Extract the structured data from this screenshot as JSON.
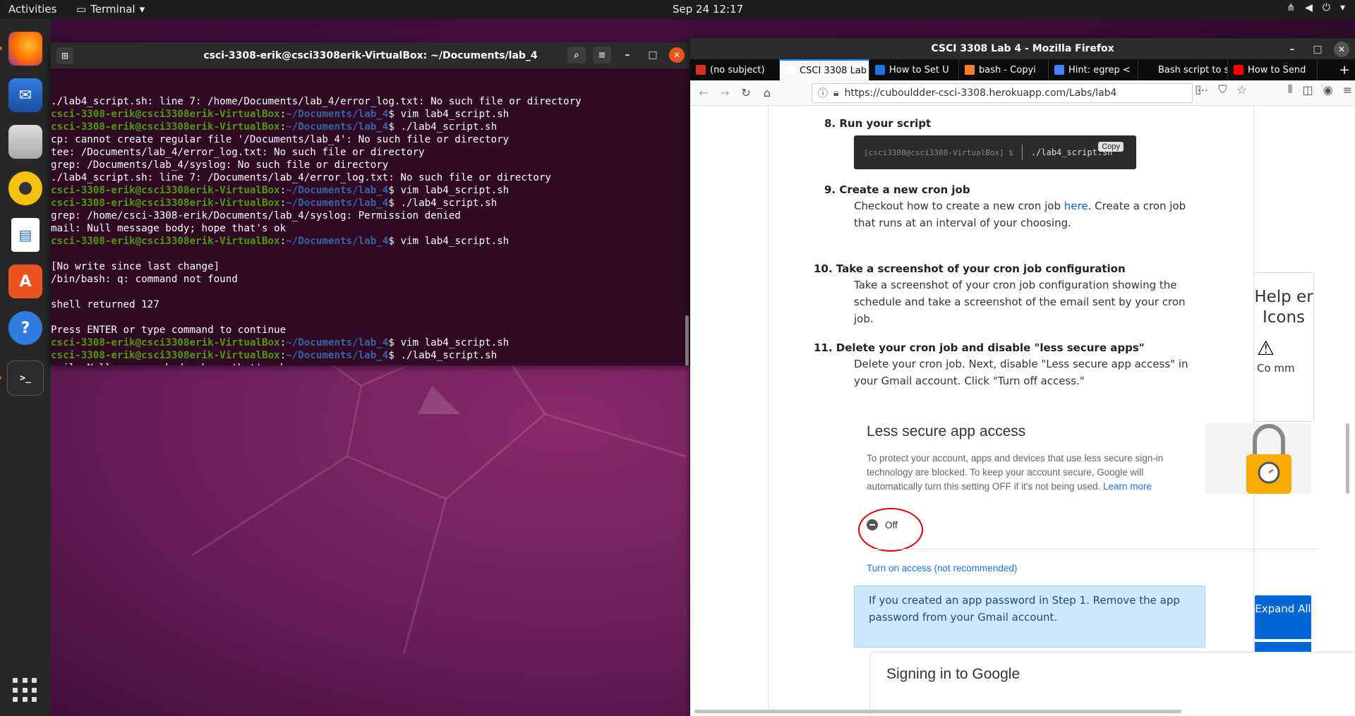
{
  "topbar": {
    "activities": "Activities",
    "app_name": "Terminal",
    "clock": "Sep 24  12:17"
  },
  "dock": {
    "items": [
      "firefox-icon",
      "thunderbird-icon",
      "files-icon",
      "rhythmbox-icon",
      "libreoffice-writer-icon",
      "ubuntu-software-icon",
      "help-icon",
      "terminal-icon"
    ]
  },
  "terminal": {
    "title": "csci-3308-erik@csci3308erik-VirtualBox: ~/Documents/lab_4",
    "prompt_user": "csci-3308-erik@csci3308erik-VirtualBox",
    "prompt_path": "~/Documents/lab_4",
    "lines": [
      {
        "type": "out",
        "text": "./lab4_script.sh: line 7: /home/Documents/lab_4/error_log.txt: No such file or directory"
      },
      {
        "type": "cmd",
        "text": "vim lab4_script.sh"
      },
      {
        "type": "cmd",
        "text": "./lab4_script.sh"
      },
      {
        "type": "out",
        "text": "cp: cannot create regular file '/Documents/lab_4': No such file or directory"
      },
      {
        "type": "out",
        "text": "tee: /Documents/lab_4/error_log.txt: No such file or directory"
      },
      {
        "type": "out",
        "text": "grep: /Documents/lab_4/syslog: No such file or directory"
      },
      {
        "type": "out",
        "text": "./lab4_script.sh: line 7: /Documents/lab_4/error_log.txt: No such file or directory"
      },
      {
        "type": "cmd",
        "text": "vim lab4_script.sh"
      },
      {
        "type": "cmd",
        "text": "./lab4_script.sh"
      },
      {
        "type": "out",
        "text": "grep: /home/csci-3308-erik/Documents/lab_4/syslog: Permission denied"
      },
      {
        "type": "out",
        "text": "mail: Null message body; hope that's ok"
      },
      {
        "type": "cmd",
        "text": "vim lab4_script.sh"
      },
      {
        "type": "out",
        "text": ""
      },
      {
        "type": "out",
        "text": "[No write since last change]"
      },
      {
        "type": "out",
        "text": "/bin/bash: q: command not found"
      },
      {
        "type": "out",
        "text": ""
      },
      {
        "type": "out",
        "text": "shell returned 127"
      },
      {
        "type": "out",
        "text": ""
      },
      {
        "type": "out",
        "text": "Press ENTER or type command to continue"
      },
      {
        "type": "cmd",
        "text": "vim lab4_script.sh"
      },
      {
        "type": "cmd",
        "text": "./lab4_script.sh"
      },
      {
        "type": "out",
        "text": "mail: Null message body; hope that's ok"
      },
      {
        "type": "cursor",
        "text": ""
      }
    ]
  },
  "firefox": {
    "title": "CSCI 3308 Lab 4 - Mozilla Firefox",
    "tabs": [
      {
        "label": "(no subject)",
        "icon": "gmail-icon",
        "color": "#d93025"
      },
      {
        "label": "CSCI 3308 Lab",
        "icon": "page-icon",
        "color": "#ffffff",
        "active": true
      },
      {
        "label": "How to Set U",
        "icon": "globe-icon",
        "color": "#1a73e8"
      },
      {
        "label": "bash - Copyi",
        "icon": "stackoverflow-icon",
        "color": "#f48024"
      },
      {
        "label": "Hint: egrep <",
        "icon": "google-icon",
        "color": "#4285f4"
      },
      {
        "label": "Bash script to se",
        "icon": "page-icon",
        "color": "#0c0c0d"
      },
      {
        "label": "How to Send",
        "icon": "youtube-icon",
        "color": "#ff0000"
      }
    ],
    "url": "https://cubouldder-csci-3308.herokuapp.com/Labs/lab4"
  },
  "page": {
    "step8": {
      "title": "8. Run your script",
      "prompt": "[csci3308@csci3308-VirtualBox] $",
      "command": "./lab4_script.sh",
      "copy": "Copy"
    },
    "step9": {
      "title": "9. Create a new cron job",
      "body_pre": "Checkout how to create a new cron job ",
      "link": "here",
      "body_post": ". Create a cron job that runs at an interval of your choosing."
    },
    "step10": {
      "title": "10. Take a screenshot of your cron job configuration",
      "body": "Take a screenshot of your cron job configuration showing the schedule and take a screenshot of the email sent by your cron job."
    },
    "step11": {
      "title": "11. Delete your cron job and disable \"less secure apps\"",
      "body": "Delete your cron job. Next, disable \"Less secure app access\" in your Gmail account. Click \"Turn off access.\""
    },
    "lsa": {
      "title": "Less secure app access",
      "body": "To protect your account, apps and devices that use less secure sign-in technology are blocked. To keep your account secure, Google will automatically turn this setting OFF if it's not being used. ",
      "learn_more": "Learn more",
      "toggle": "Off",
      "turn_on": "Turn on access (not recommended)"
    },
    "info": "If you created an app password in Step 1. Remove the app password from your Gmail account.",
    "signing": "Signing in to Google",
    "helper": {
      "title": "Help er Icons",
      "co": "Co mm"
    },
    "expand": "Expand All"
  }
}
